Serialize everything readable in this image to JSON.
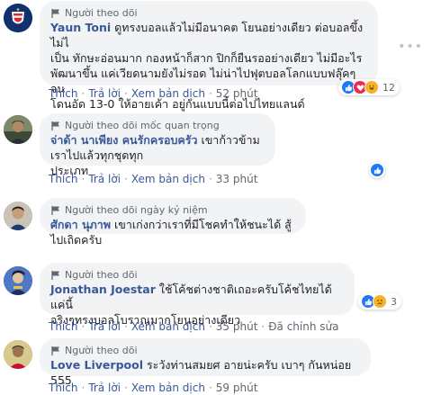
{
  "colors": {
    "link": "#385898",
    "bubble": "#f2f3f5",
    "meta": "#606770",
    "like": "#2078f4",
    "love": "#f0284a",
    "haha": "#f7b125"
  },
  "actions": {
    "like": "Thích",
    "reply": "Trả lời",
    "translate": "Xem bản dịch",
    "separator": "·"
  },
  "comments": [
    {
      "badge": "Người theo dõi",
      "badge_icon": "flag-icon",
      "name": "Yaun Toni",
      "lines": [
        "ดูทรงบอลแล้วไม่มีอนาคต โยนอย่างเดียว ต่อบอลขึ้งไม่ไ",
        "เป็น ทักษะอ่อนมาก กองหน้าก็สาก ปิกก็ยืนรออย่างเดียว ไม่มีอะไร",
        "พัฒนาขึ้น แค่เวียดนามยังไม่รอด ไม่น่าไปฟุตบอลโลกแบบฟลุ๊คๆจน",
        "โดนอัด 13-0 ให้อายเค้า อยู่กันแบบนี้ต่อไปไทยแลนด์"
      ],
      "time": "52 phút",
      "reactions": [
        "like-icon",
        "love-icon",
        "haha-icon"
      ],
      "reaction_count": "12",
      "edited": ""
    },
    {
      "badge": "Người theo dõi mốc quan trọng",
      "badge_icon": "flag-icon",
      "name": "จ่าด้า นาเพียง คนรักครอบครัว",
      "lines": [
        "เขาก้าวข้ามเราไปแล้วทุกชุดทุก",
        "ประเภท"
      ],
      "time": "33 phút",
      "reactions": [
        "like-icon"
      ],
      "reaction_count": "",
      "edited": ""
    },
    {
      "badge": "Người theo dõi ngày kỷ niệm",
      "badge_icon": "flag-icon",
      "name": "ศักดา นุภาพ",
      "lines": [
        "เขาเก่งกว่าเราที่มีโชคทำให้ชนะได้ สู้ไปเถิดครับ"
      ],
      "time": "",
      "reactions": [],
      "reaction_count": "",
      "edited": ""
    },
    {
      "badge": "Người theo dõi",
      "badge_icon": "flag-icon",
      "name": "Jonathan Joestar",
      "lines": [
        "ใช้โค้ชต่างชาติเถอะครับโค้ชไทยได้แค่นี้",
        "จริงๆทรงบอลโบราณมากโยนอย่างเดียว"
      ],
      "time": "35 phút",
      "reactions": [
        "like-icon",
        "sad-icon"
      ],
      "reaction_count": "3",
      "edited": "Đã chỉnh sửa"
    },
    {
      "badge": "Người theo dõi",
      "badge_icon": "flag-icon",
      "name": "Love Liverpool",
      "lines": [
        "ระวังท่านสมยศ อายน่ะครับ เบาๆ กันหน่อย 555"
      ],
      "time": "59 phút",
      "reactions": [],
      "reaction_count": "",
      "edited": ""
    }
  ]
}
